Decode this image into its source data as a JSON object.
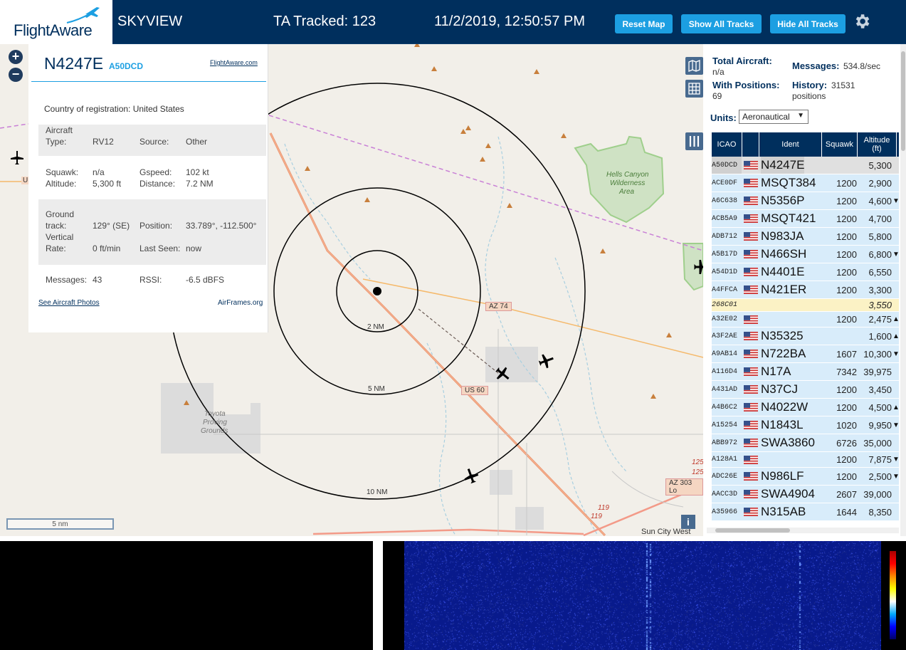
{
  "header": {
    "logo_text": "FlightAware",
    "app_title": "SKYVIEW",
    "tracked_label": "TA Tracked: 123",
    "datetime": "11/2/2019, 12:50:57 PM",
    "reset_label": "Reset Map",
    "show_label": "Show All Tracks",
    "hide_label": "Hide All Tracks"
  },
  "map": {
    "ring_labels": [
      "2 NM",
      "5 NM",
      "10 NM"
    ],
    "roads": {
      "az74": "AZ 74",
      "us60": "US 60",
      "az303": "AZ 303 Lo",
      "r119a": "119",
      "r119b": "119",
      "r125a": "125",
      "r125b": "125"
    },
    "places": {
      "hells": "Hells Canyon",
      "wilderness": "Wilderness",
      "area": "Area",
      "toyota": "Toyota",
      "proving": "Proving",
      "grounds": "Grounds",
      "suncity": "Sun City West",
      "u": "U"
    },
    "scale_label": "5 nm",
    "zoom_in": "+",
    "zoom_out": "−",
    "info_btn": "i"
  },
  "info_panel": {
    "ident": "N4247E",
    "icao": "A50DCD",
    "fa_link": "FlightAware.com",
    "country_label": "Country of registration:",
    "country": "United States",
    "aircraft_type_label_1": "Aircraft",
    "aircraft_type_label_2": "Type:",
    "aircraft_type": "RV12",
    "source_label": "Source:",
    "source": "Other",
    "squawk_label": "Squawk:",
    "squawk": "n/a",
    "gspeed_label": "Gspeed:",
    "gspeed": "102 kt",
    "altitude_label": "Altitude:",
    "altitude": "5,300 ft",
    "distance_label": "Distance:",
    "distance": "7.2 NM",
    "track_label_1": "Ground",
    "track_label_2": "track:",
    "track": "129° (SE)",
    "position_label": "Position:",
    "position": "33.789°, -112.500°",
    "vrate_label_1": "Vertical",
    "vrate_label_2": "Rate:",
    "vrate": "0 ft/min",
    "last_seen_label": "Last Seen:",
    "last_seen": "now",
    "messages_label": "Messages:",
    "messages": "43",
    "rssi_label": "RSSI:",
    "rssi": "-6.5 dBFS",
    "photos_link": "See Aircraft Photos",
    "airframes_link": "AirFrames.org"
  },
  "sidebar": {
    "total_label": "Total Aircraft:",
    "total_value": "n/a",
    "messages_label": "Messages:",
    "messages_value": "534.8/sec",
    "positions_label": "With Positions:",
    "positions_value": "69",
    "history_label": "History:",
    "history_value_1": "31531",
    "history_value_2": "positions",
    "units_label": "Units:",
    "units_value": "Aeronautical",
    "columns": {
      "icao": "ICAO",
      "ident": "Ident",
      "squawk": "Squawk",
      "alt1": "Altitude",
      "alt2": "(ft)"
    },
    "rows": [
      {
        "icao": "A50DCD",
        "ident": "N4247E",
        "squawk": "",
        "alt": "5,300",
        "trend": ""
      },
      {
        "icao": "ACE0DF",
        "ident": "MSQT384",
        "squawk": "1200",
        "alt": "2,900",
        "trend": ""
      },
      {
        "icao": "A6C638",
        "ident": "N5356P",
        "squawk": "1200",
        "alt": "4,600",
        "trend": "▼"
      },
      {
        "icao": "ACB5A9",
        "ident": "MSQT421",
        "squawk": "1200",
        "alt": "4,700",
        "trend": ""
      },
      {
        "icao": "ADB712",
        "ident": "N983JA",
        "squawk": "1200",
        "alt": "5,800",
        "trend": ""
      },
      {
        "icao": "A5B17D",
        "ident": "N466SH",
        "squawk": "1200",
        "alt": "6,800",
        "trend": "▼"
      },
      {
        "icao": "A54D1D",
        "ident": "N4401E",
        "squawk": "1200",
        "alt": "6,550",
        "trend": ""
      },
      {
        "icao": "A4FFCA",
        "ident": "N421ER",
        "squawk": "1200",
        "alt": "3,300",
        "trend": ""
      },
      {
        "icao": "268C01",
        "ident": "",
        "squawk": "",
        "alt": "3,550",
        "trend": ""
      },
      {
        "icao": "A32E02",
        "ident": "",
        "squawk": "1200",
        "alt": "2,475",
        "trend": "▲"
      },
      {
        "icao": "A3F2AE",
        "ident": "N35325",
        "squawk": "",
        "alt": "1,600",
        "trend": "▲"
      },
      {
        "icao": "A9AB14",
        "ident": "N722BA",
        "squawk": "1607",
        "alt": "10,300",
        "trend": "▼"
      },
      {
        "icao": "A116D4",
        "ident": "N17A",
        "squawk": "7342",
        "alt": "39,975",
        "trend": ""
      },
      {
        "icao": "A431AD",
        "ident": "N37CJ",
        "squawk": "1200",
        "alt": "3,450",
        "trend": ""
      },
      {
        "icao": "A4B6C2",
        "ident": "N4022W",
        "squawk": "1200",
        "alt": "4,500",
        "trend": "▲"
      },
      {
        "icao": "A15254",
        "ident": "N1843L",
        "squawk": "1020",
        "alt": "9,950",
        "trend": "▼"
      },
      {
        "icao": "ABB972",
        "ident": "SWA3860",
        "squawk": "6726",
        "alt": "35,000",
        "trend": ""
      },
      {
        "icao": "A128A1",
        "ident": "",
        "squawk": "1200",
        "alt": "7,875",
        "trend": "▼"
      },
      {
        "icao": "ADC26E",
        "ident": "N986LF",
        "squawk": "1200",
        "alt": "2,500",
        "trend": "▼"
      },
      {
        "icao": "AACC3D",
        "ident": "SWA4904",
        "squawk": "2607",
        "alt": "39,000",
        "trend": ""
      },
      {
        "icao": "A35966",
        "ident": "N315AB",
        "squawk": "1644",
        "alt": "8,350",
        "trend": ""
      }
    ]
  },
  "colors": {
    "header_bg": "#002f5d",
    "button": "#1c9fe2",
    "row_bg": "#d8ecfa",
    "mlat_row": "#fbf2c5",
    "waterfall": "#081a8c"
  }
}
